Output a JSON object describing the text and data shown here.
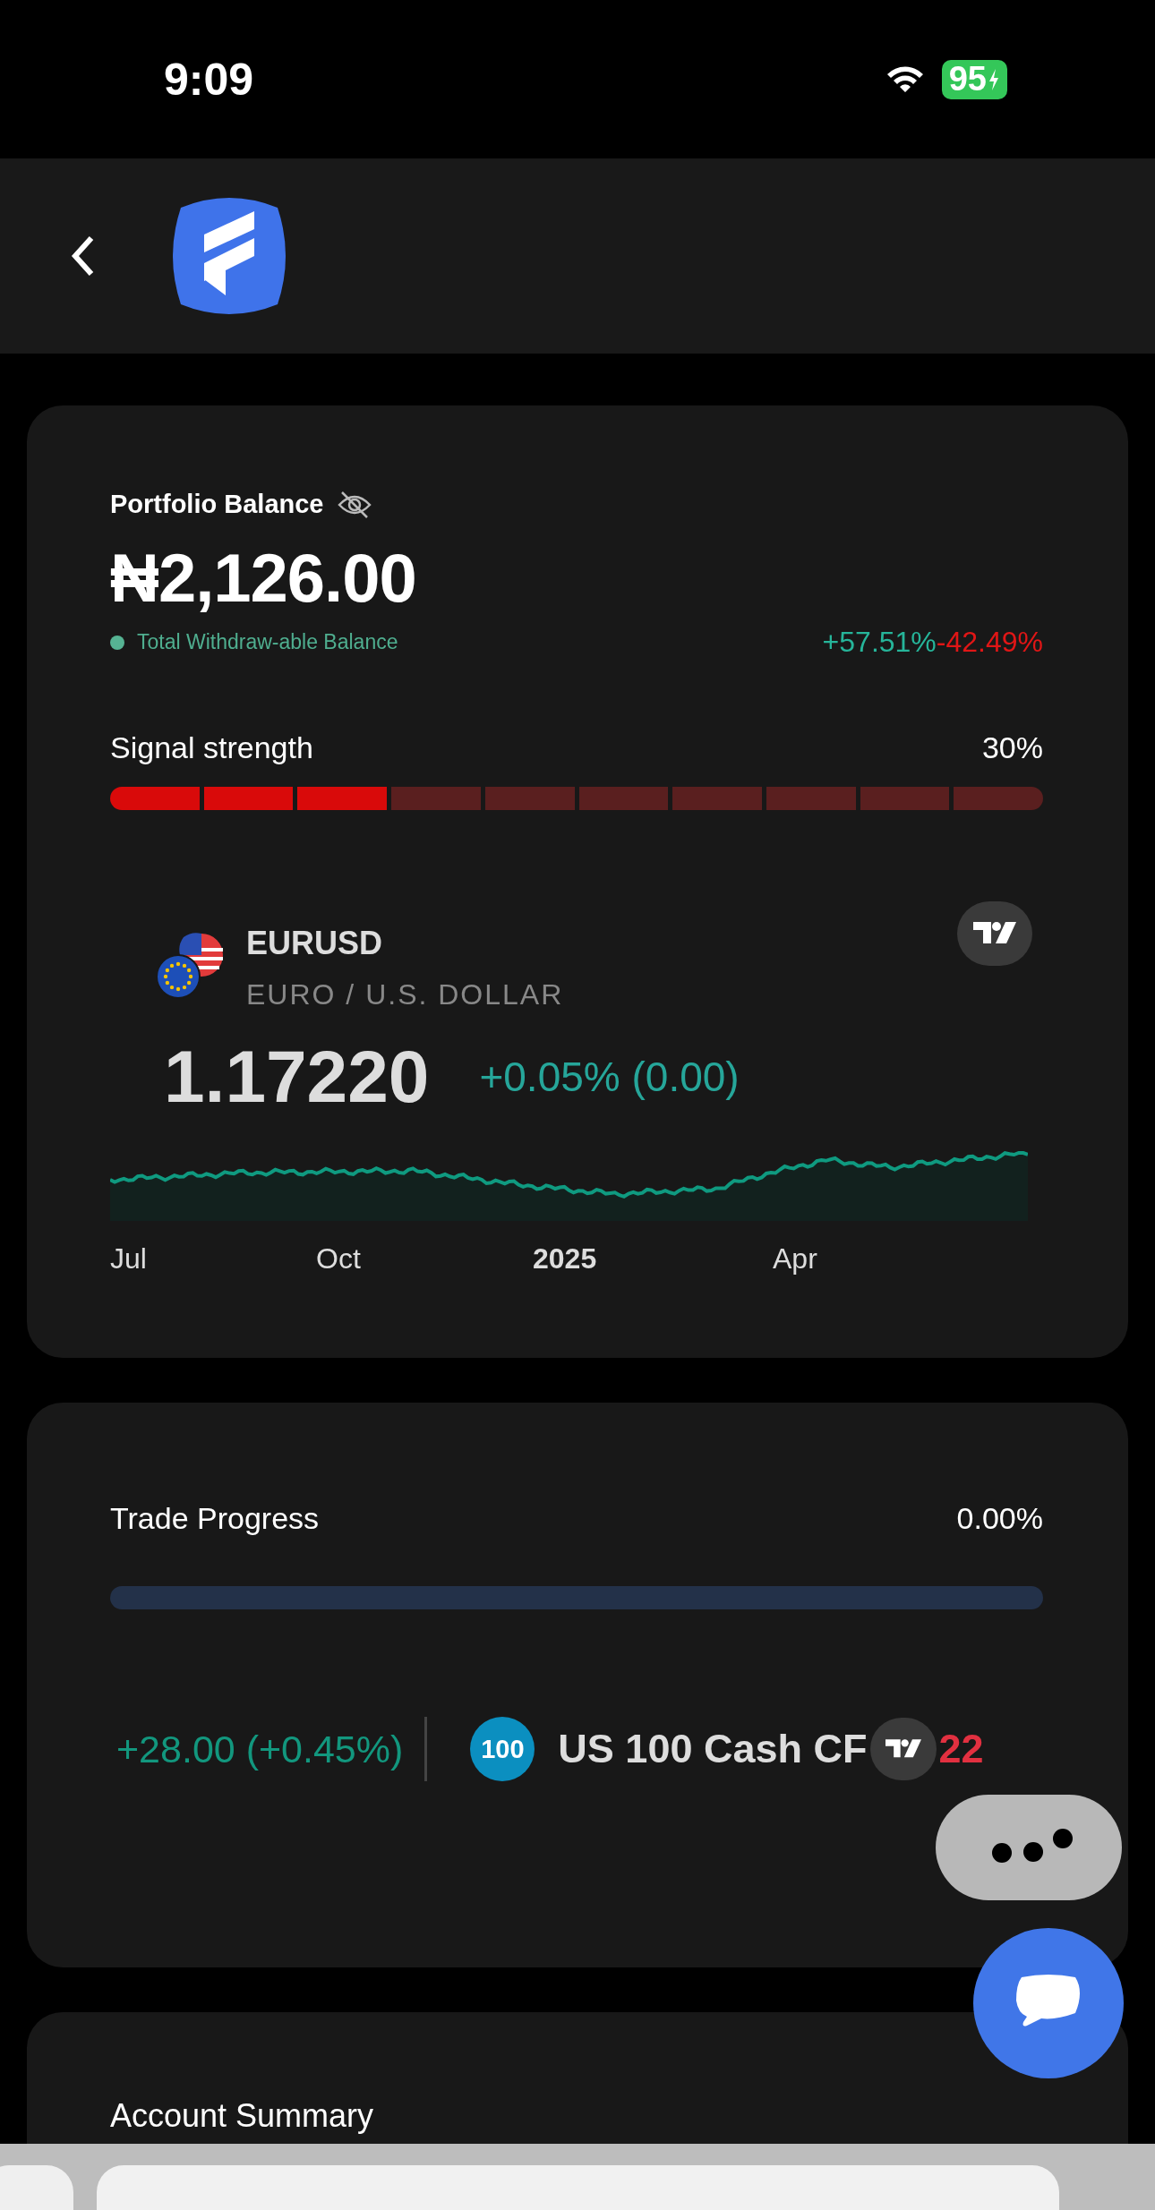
{
  "status_bar": {
    "time": "9:09",
    "battery": "95"
  },
  "portfolio": {
    "title": "Portfolio Balance",
    "balance": "₦2,126.00",
    "withdrawable_label": "Total Withdraw-able Balance",
    "gain": "+57.51%",
    "loss": "-42.49%",
    "signal": {
      "label": "Signal strength",
      "reading": "30%",
      "level": 0.3
    }
  },
  "ticker_widget": {
    "symbol": "EURUSD",
    "name": "EURO / U.S. DOLLAR",
    "price": "1.17220",
    "change": "+0.05% (0.00)",
    "axis_labels": [
      {
        "label": "Jul",
        "bold": false
      },
      {
        "label": "Oct",
        "bold": false
      },
      {
        "label": "2025",
        "bold": true
      },
      {
        "label": "Apr",
        "bold": false
      }
    ]
  },
  "trade_progress": {
    "label": "Trade Progress",
    "reading": "0.00%",
    "level": 0
  },
  "ticker_tape": {
    "change": "+28.00 (+0.45%)",
    "badge": "100",
    "name": "US 100 Cash CF",
    "next_value": "22"
  },
  "account_summary": {
    "title": "Account Summary"
  }
}
